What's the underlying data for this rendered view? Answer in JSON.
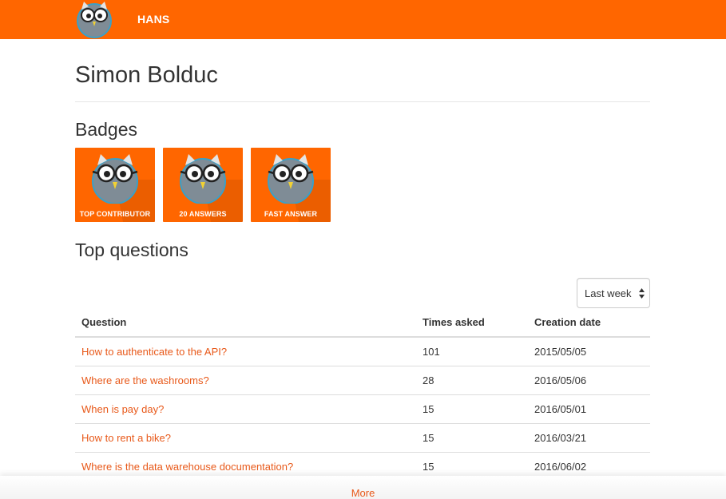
{
  "header": {
    "brand": "HANS",
    "logo_icon": "owl-logo-icon",
    "background": "#ff6600"
  },
  "profile": {
    "name": "Simon Bolduc"
  },
  "badges": {
    "title": "Badges",
    "items": [
      {
        "label": "TOP CONTRIBUTOR",
        "icon": "owl-icon"
      },
      {
        "label": "20 ANSWERS",
        "icon": "owl-icon"
      },
      {
        "label": "FAST ANSWER",
        "icon": "owl-icon"
      }
    ]
  },
  "questions": {
    "title": "Top questions",
    "period_select": {
      "selected": "Last week"
    },
    "columns": [
      "Question",
      "Times asked",
      "Creation date"
    ],
    "rows": [
      {
        "question": "How to authenticate to the API?",
        "times": "101",
        "date": "2015/05/05"
      },
      {
        "question": "Where are the washrooms?",
        "times": "28",
        "date": "2016/05/06"
      },
      {
        "question": "When is pay day?",
        "times": "15",
        "date": "2016/05/01"
      },
      {
        "question": "How to rent a bike?",
        "times": "15",
        "date": "2016/03/21"
      },
      {
        "question": "Where is the data warehouse documentation?",
        "times": "15",
        "date": "2016/06/02"
      }
    ],
    "more_label": "More"
  },
  "colors": {
    "accent": "#ff6600",
    "link": "#e8591a"
  }
}
